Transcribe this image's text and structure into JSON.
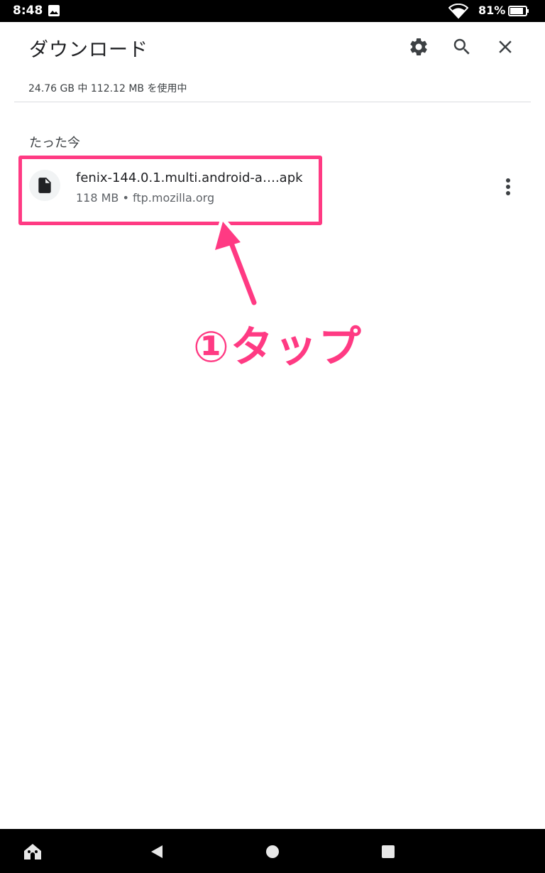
{
  "status_bar": {
    "time": "8:48",
    "battery_text": "81%",
    "icons": [
      "image-icon",
      "wifi-icon",
      "battery-icon"
    ]
  },
  "app_bar": {
    "title": "ダウンロード",
    "actions": [
      "gear-icon",
      "search-icon",
      "close-icon"
    ]
  },
  "storage": {
    "text": "24.76 GB 中 112.12 MB を使用中"
  },
  "section": {
    "title": "たった今"
  },
  "downloads": [
    {
      "name": "fenix-144.0.1.multi.android-a….apk",
      "meta": "118 MB • ftp.mozilla.org",
      "icon": "file-icon"
    }
  ],
  "annotation": {
    "text": "①タップ",
    "color": "#ff3a83"
  },
  "nav_bar": {
    "icons": [
      "home-icon",
      "back-icon",
      "circle-home-icon",
      "recents-icon"
    ]
  },
  "colors": {
    "accent": "#ff3a83",
    "title_text": "#202124",
    "secondary_text": "#5f6368"
  }
}
